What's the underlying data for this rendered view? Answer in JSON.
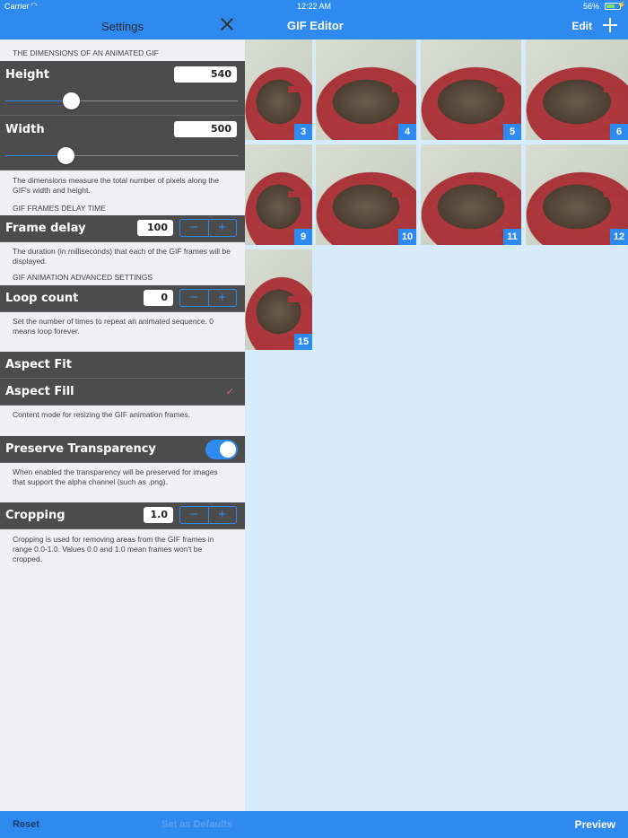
{
  "status_bar": {
    "carrier": "Carrier",
    "time": "12:22 AM",
    "battery": "56%",
    "battery_level": 0.56
  },
  "settings": {
    "title": "Settings",
    "dimensions": {
      "header": "THE DIMENSIONS OF AN ANIMATED GIF",
      "height_label": "Height",
      "height_value": "540",
      "height_slider": 0.28,
      "width_label": "Width",
      "width_value": "500",
      "width_slider": 0.26,
      "footnote": "The dimensions measure the total number of pixels along the GIF's width and height."
    },
    "delay": {
      "header": "GIF FRAMES DELAY TIME",
      "label": "Frame delay",
      "value": "100",
      "minus": "−",
      "plus": "+",
      "footnote": "The duration (in milliseconds) that each of the GIF frames will be displayed."
    },
    "advanced": {
      "header": "GIF ANIMATION ADVANCED SETTINGS",
      "loop_label": "Loop count",
      "loop_value": "0",
      "minus": "−",
      "plus": "+",
      "loop_footnote": "Set the number of times to repeat an animated sequence. 0 means loop forever."
    },
    "content_mode": {
      "aspect_fit": "Aspect Fit",
      "aspect_fill": "Aspect Fill",
      "checkmark": "✓",
      "selected": "Aspect Fill",
      "footnote": "Content mode for resizing the GIF animation frames."
    },
    "transparency": {
      "label": "Preserve Transparency",
      "enabled": true,
      "footnote": "When enabled the transparency will be preserved for images that support  the alpha channel (such as .png)."
    },
    "cropping": {
      "label": "Cropping",
      "value": "1.0",
      "minus": "−",
      "plus": "+",
      "footnote": "Cropping is used for removing areas from the GIF frames in range 0.0-1.0. Values 0.0 and 1.0 mean frames won't be cropped."
    },
    "footer": {
      "reset": "Reset",
      "set_defaults": "Set as Defaults"
    }
  },
  "editor": {
    "title": "GIF Editor",
    "edit": "Edit",
    "preview": "Preview",
    "frames": [
      "3",
      "4",
      "5",
      "6",
      "9",
      "10",
      "11",
      "12",
      "15"
    ]
  },
  "colors": {
    "accent": "#2f8af0",
    "row_background": "#4c4c4c",
    "editor_background": "#d6ebfc",
    "checkmark": "#e46a7a"
  }
}
